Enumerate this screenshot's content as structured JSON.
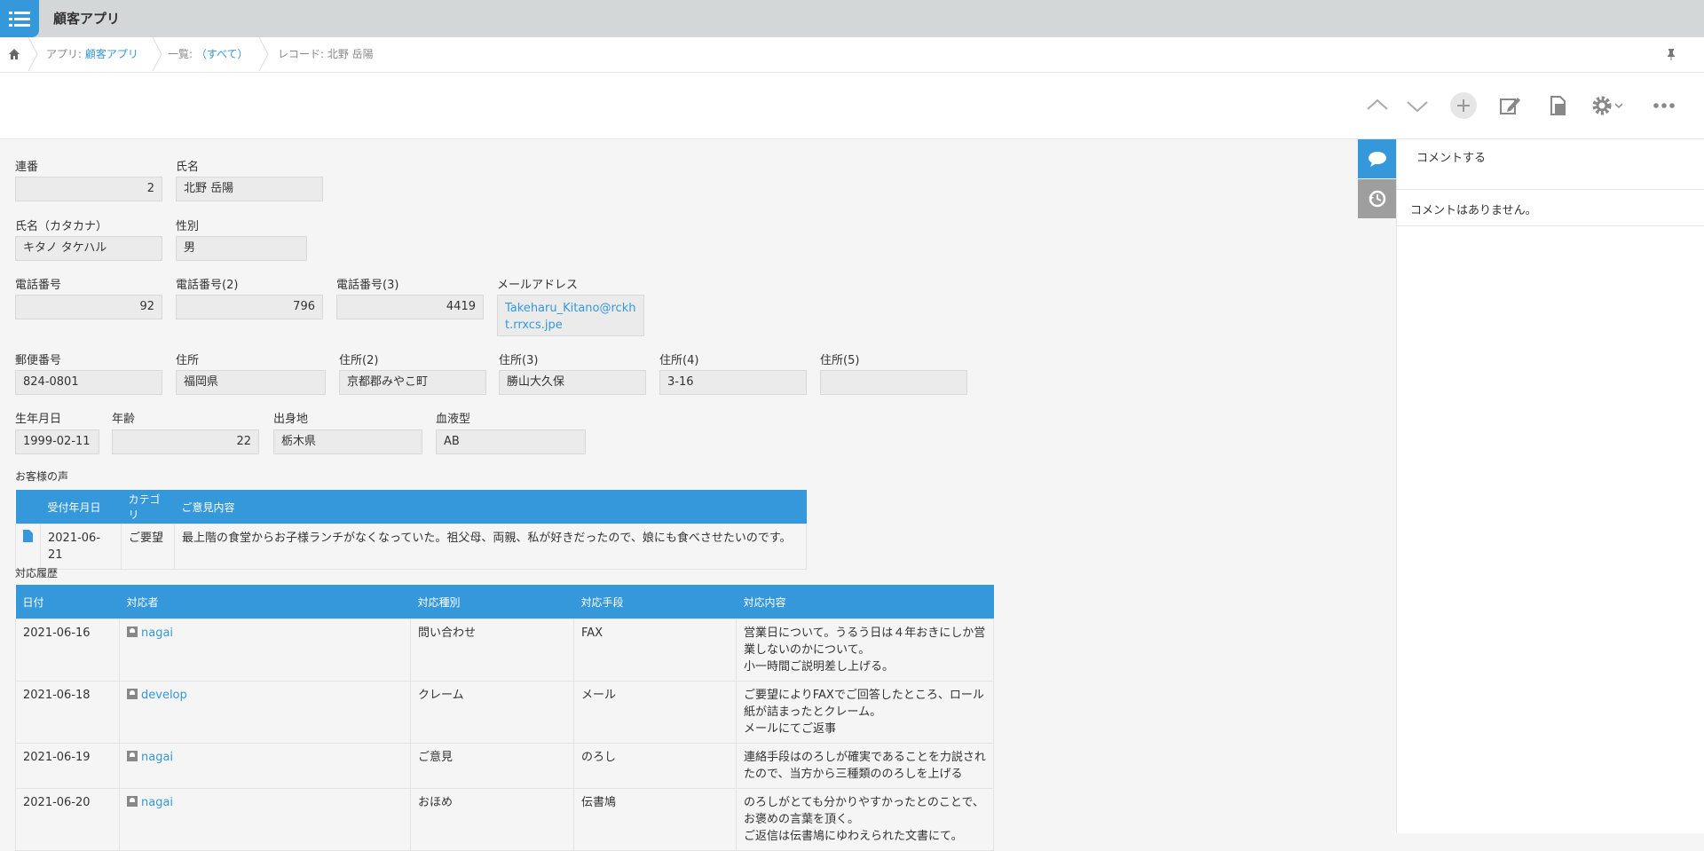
{
  "app": {
    "title": "顧客アプリ"
  },
  "breadcrumb": {
    "app_prefix": "アプリ: ",
    "app_name": "顧客アプリ",
    "list_prefix": "一覧: ",
    "list_name": "（すべて）",
    "record": "レコード: 北野 岳陽"
  },
  "toolbar": {
    "icons": [
      "chevron-up-icon",
      "chevron-down-icon",
      "plus-icon",
      "edit-icon",
      "duplicate-icon",
      "gear-icon",
      "more-icon"
    ]
  },
  "fields": {
    "renban": {
      "label": "連番",
      "value": "2"
    },
    "shimei": {
      "label": "氏名",
      "value": "北野 岳陽"
    },
    "kana": {
      "label": "氏名（カタカナ）",
      "value": "キタノ タケハル"
    },
    "seibetsu": {
      "label": "性別",
      "value": "男"
    },
    "tel1": {
      "label": "電話番号",
      "value": "92"
    },
    "tel2": {
      "label": "電話番号(2)",
      "value": "796"
    },
    "tel3": {
      "label": "電話番号(3)",
      "value": "4419"
    },
    "email": {
      "label": "メールアドレス",
      "value": "Takeharu_Kitano@rckht.rrxcs.jpe"
    },
    "zip": {
      "label": "郵便番号",
      "value": "824-0801"
    },
    "addr1": {
      "label": "住所",
      "value": "福岡県"
    },
    "addr2": {
      "label": "住所(2)",
      "value": "京都郡みやこ町"
    },
    "addr3": {
      "label": "住所(3)",
      "value": "勝山大久保"
    },
    "addr4": {
      "label": "住所(4)",
      "value": "3-16"
    },
    "addr5": {
      "label": "住所(5)",
      "value": ""
    },
    "birthday": {
      "label": "生年月日",
      "value": "1999-02-11"
    },
    "age": {
      "label": "年齢",
      "value": "22"
    },
    "birthplace": {
      "label": "出身地",
      "value": "栃木県"
    },
    "blood": {
      "label": "血液型",
      "value": "AB"
    }
  },
  "voice": {
    "title": "お客様の声",
    "headers": [
      "受付年月日",
      "カテゴリ",
      "ご意見内容"
    ],
    "rows": [
      {
        "date": "2021-06-21",
        "category": "ご要望",
        "content": "最上階の食堂からお子様ランチがなくなっていた。祖父母、両親、私が好きだったので、娘にも食べさせたいのです。"
      }
    ]
  },
  "history": {
    "title": "対応履歴",
    "headers": [
      "日付",
      "対応者",
      "対応種別",
      "対応手段",
      "対応内容"
    ],
    "rows": [
      {
        "date": "2021-06-16",
        "user": "nagai",
        "type": "問い合わせ",
        "method": "FAX",
        "content": [
          "営業日について。うるう日は４年おきにしか営",
          "業しないのかについて。",
          "小一時間ご説明差し上げる。"
        ]
      },
      {
        "date": "2021-06-18",
        "user": "develop",
        "type": "クレーム",
        "method": "メール",
        "content": [
          "ご要望によりFAXでご回答したところ、ロール",
          "紙が詰まったとクレーム。",
          "メールにてご返事"
        ]
      },
      {
        "date": "2021-06-19",
        "user": "nagai",
        "type": "ご意見",
        "method": "のろし",
        "content": [
          "連絡手段はのろしが確実であることを力説され",
          "たので、当方から三種類ののろしを上げる"
        ]
      },
      {
        "date": "2021-06-20",
        "user": "nagai",
        "type": "おほめ",
        "method": "伝書鳩",
        "content": [
          "のろしがとても分かりやすかったとのことで、",
          "お褒めの言葉を頂く。",
          "ご返信は伝書鳩にゆわえられた文書にて。"
        ]
      }
    ]
  },
  "sidebar": {
    "comment_placeholder": "コメントする",
    "empty_text": "コメントはありません。"
  },
  "colors": {
    "accent": "#3498db",
    "topbar": "#d4d7d7"
  }
}
